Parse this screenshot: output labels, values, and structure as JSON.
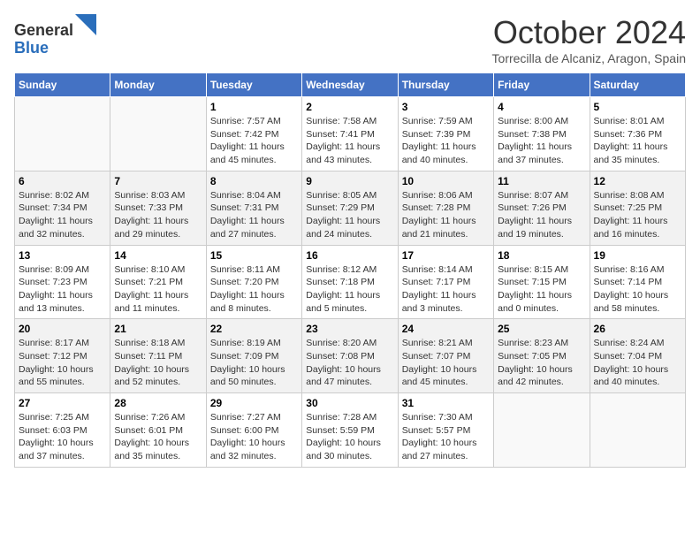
{
  "header": {
    "logo_line1": "General",
    "logo_line2": "Blue",
    "month_title": "October 2024",
    "location": "Torrecilla de Alcaniz, Aragon, Spain"
  },
  "days_of_week": [
    "Sunday",
    "Monday",
    "Tuesday",
    "Wednesday",
    "Thursday",
    "Friday",
    "Saturday"
  ],
  "weeks": [
    [
      {
        "day": "",
        "info": ""
      },
      {
        "day": "",
        "info": ""
      },
      {
        "day": "1",
        "info": "Sunrise: 7:57 AM\nSunset: 7:42 PM\nDaylight: 11 hours and 45 minutes."
      },
      {
        "day": "2",
        "info": "Sunrise: 7:58 AM\nSunset: 7:41 PM\nDaylight: 11 hours and 43 minutes."
      },
      {
        "day": "3",
        "info": "Sunrise: 7:59 AM\nSunset: 7:39 PM\nDaylight: 11 hours and 40 minutes."
      },
      {
        "day": "4",
        "info": "Sunrise: 8:00 AM\nSunset: 7:38 PM\nDaylight: 11 hours and 37 minutes."
      },
      {
        "day": "5",
        "info": "Sunrise: 8:01 AM\nSunset: 7:36 PM\nDaylight: 11 hours and 35 minutes."
      }
    ],
    [
      {
        "day": "6",
        "info": "Sunrise: 8:02 AM\nSunset: 7:34 PM\nDaylight: 11 hours and 32 minutes."
      },
      {
        "day": "7",
        "info": "Sunrise: 8:03 AM\nSunset: 7:33 PM\nDaylight: 11 hours and 29 minutes."
      },
      {
        "day": "8",
        "info": "Sunrise: 8:04 AM\nSunset: 7:31 PM\nDaylight: 11 hours and 27 minutes."
      },
      {
        "day": "9",
        "info": "Sunrise: 8:05 AM\nSunset: 7:29 PM\nDaylight: 11 hours and 24 minutes."
      },
      {
        "day": "10",
        "info": "Sunrise: 8:06 AM\nSunset: 7:28 PM\nDaylight: 11 hours and 21 minutes."
      },
      {
        "day": "11",
        "info": "Sunrise: 8:07 AM\nSunset: 7:26 PM\nDaylight: 11 hours and 19 minutes."
      },
      {
        "day": "12",
        "info": "Sunrise: 8:08 AM\nSunset: 7:25 PM\nDaylight: 11 hours and 16 minutes."
      }
    ],
    [
      {
        "day": "13",
        "info": "Sunrise: 8:09 AM\nSunset: 7:23 PM\nDaylight: 11 hours and 13 minutes."
      },
      {
        "day": "14",
        "info": "Sunrise: 8:10 AM\nSunset: 7:21 PM\nDaylight: 11 hours and 11 minutes."
      },
      {
        "day": "15",
        "info": "Sunrise: 8:11 AM\nSunset: 7:20 PM\nDaylight: 11 hours and 8 minutes."
      },
      {
        "day": "16",
        "info": "Sunrise: 8:12 AM\nSunset: 7:18 PM\nDaylight: 11 hours and 5 minutes."
      },
      {
        "day": "17",
        "info": "Sunrise: 8:14 AM\nSunset: 7:17 PM\nDaylight: 11 hours and 3 minutes."
      },
      {
        "day": "18",
        "info": "Sunrise: 8:15 AM\nSunset: 7:15 PM\nDaylight: 11 hours and 0 minutes."
      },
      {
        "day": "19",
        "info": "Sunrise: 8:16 AM\nSunset: 7:14 PM\nDaylight: 10 hours and 58 minutes."
      }
    ],
    [
      {
        "day": "20",
        "info": "Sunrise: 8:17 AM\nSunset: 7:12 PM\nDaylight: 10 hours and 55 minutes."
      },
      {
        "day": "21",
        "info": "Sunrise: 8:18 AM\nSunset: 7:11 PM\nDaylight: 10 hours and 52 minutes."
      },
      {
        "day": "22",
        "info": "Sunrise: 8:19 AM\nSunset: 7:09 PM\nDaylight: 10 hours and 50 minutes."
      },
      {
        "day": "23",
        "info": "Sunrise: 8:20 AM\nSunset: 7:08 PM\nDaylight: 10 hours and 47 minutes."
      },
      {
        "day": "24",
        "info": "Sunrise: 8:21 AM\nSunset: 7:07 PM\nDaylight: 10 hours and 45 minutes."
      },
      {
        "day": "25",
        "info": "Sunrise: 8:23 AM\nSunset: 7:05 PM\nDaylight: 10 hours and 42 minutes."
      },
      {
        "day": "26",
        "info": "Sunrise: 8:24 AM\nSunset: 7:04 PM\nDaylight: 10 hours and 40 minutes."
      }
    ],
    [
      {
        "day": "27",
        "info": "Sunrise: 7:25 AM\nSunset: 6:03 PM\nDaylight: 10 hours and 37 minutes."
      },
      {
        "day": "28",
        "info": "Sunrise: 7:26 AM\nSunset: 6:01 PM\nDaylight: 10 hours and 35 minutes."
      },
      {
        "day": "29",
        "info": "Sunrise: 7:27 AM\nSunset: 6:00 PM\nDaylight: 10 hours and 32 minutes."
      },
      {
        "day": "30",
        "info": "Sunrise: 7:28 AM\nSunset: 5:59 PM\nDaylight: 10 hours and 30 minutes."
      },
      {
        "day": "31",
        "info": "Sunrise: 7:30 AM\nSunset: 5:57 PM\nDaylight: 10 hours and 27 minutes."
      },
      {
        "day": "",
        "info": ""
      },
      {
        "day": "",
        "info": ""
      }
    ]
  ]
}
